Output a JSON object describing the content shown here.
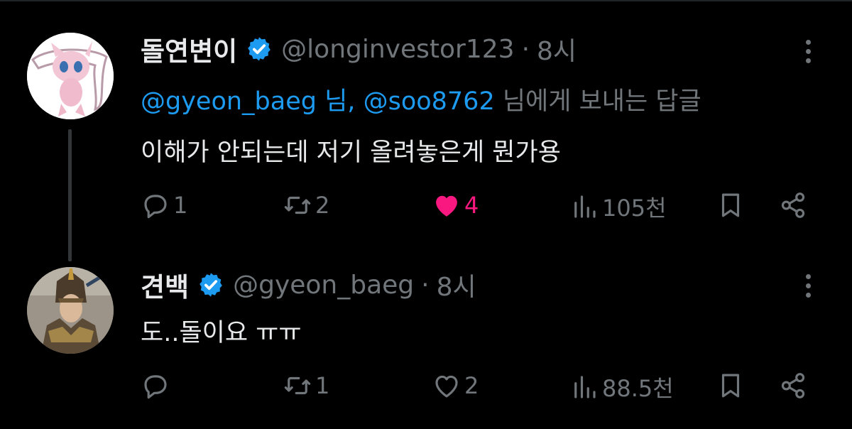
{
  "tweets": [
    {
      "author_name": "돌연변이",
      "handle": "@longinvestor123",
      "time": "8시",
      "reply_to": {
        "mention1": "@gyeon_baeg 님,",
        "mention2": "@soo8762",
        "suffix": " 님에게 보내는 답글"
      },
      "text": "이해가 안되는데 저기 올려놓은게 뭔가용",
      "replies": "1",
      "retweets": "2",
      "likes": "4",
      "views": "105천",
      "liked": true,
      "avatar_icon": "mew-pokemon-avatar"
    },
    {
      "author_name": "견백",
      "handle": "@gyeon_baeg",
      "time": "8시",
      "text": "도..돌이요 ㅠㅠ",
      "replies": "",
      "retweets": "1",
      "likes": "2",
      "views": "88.5천",
      "liked": false,
      "avatar_icon": "armored-warrior-avatar"
    }
  ],
  "separator": "·",
  "colors": {
    "background": "#000000",
    "text": "#e7e9ea",
    "muted": "#71767b",
    "mention": "#1d9bf0",
    "like": "#f91880",
    "verified": "#1d9bf0"
  }
}
